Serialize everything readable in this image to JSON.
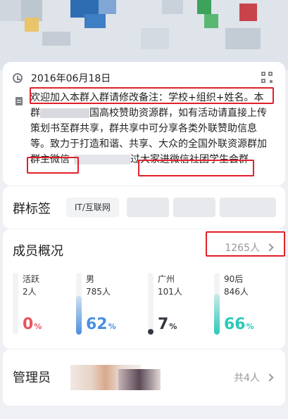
{
  "group": {
    "created_date": "2016年06月18日",
    "description_line1": "欢迎加入本群入群请修改备注：学校+组织+姓名。本",
    "description_line2_pre": "群",
    "description_line2_post": "国高校赞助资源群，如有活动请直接上传",
    "description_line3": "策划书至群共享，群共享中可分享各类外联赞助信息",
    "description_line4": "等。致力于打造和谐、共享、大众的全国外联资源群加",
    "description_line5_a": "群主微信",
    "description_line5_b": "过",
    "description_line5_c": "大家进微信社团学生会群"
  },
  "tags": {
    "title": "群标签",
    "items": [
      "IT/互联网"
    ]
  },
  "members": {
    "title": "成员概况",
    "total": "1265人",
    "stats": [
      {
        "label": "活跃",
        "count": "2人",
        "percent": "0",
        "fraction": 0.0,
        "color": "#e8535f"
      },
      {
        "label": "男",
        "count": "785人",
        "percent": "62",
        "fraction": 0.62,
        "color": "#4a8fe0"
      },
      {
        "label": "广州",
        "count": "101人",
        "percent": "7",
        "fraction": 0.07,
        "color": "#333840"
      },
      {
        "label": "90后",
        "count": "846人",
        "percent": "66",
        "fraction": 0.66,
        "color": "#2cc9b8"
      }
    ]
  },
  "admins": {
    "title": "管理员",
    "count": "共4人"
  },
  "colors": {
    "highlight_box": "#e0202a"
  }
}
